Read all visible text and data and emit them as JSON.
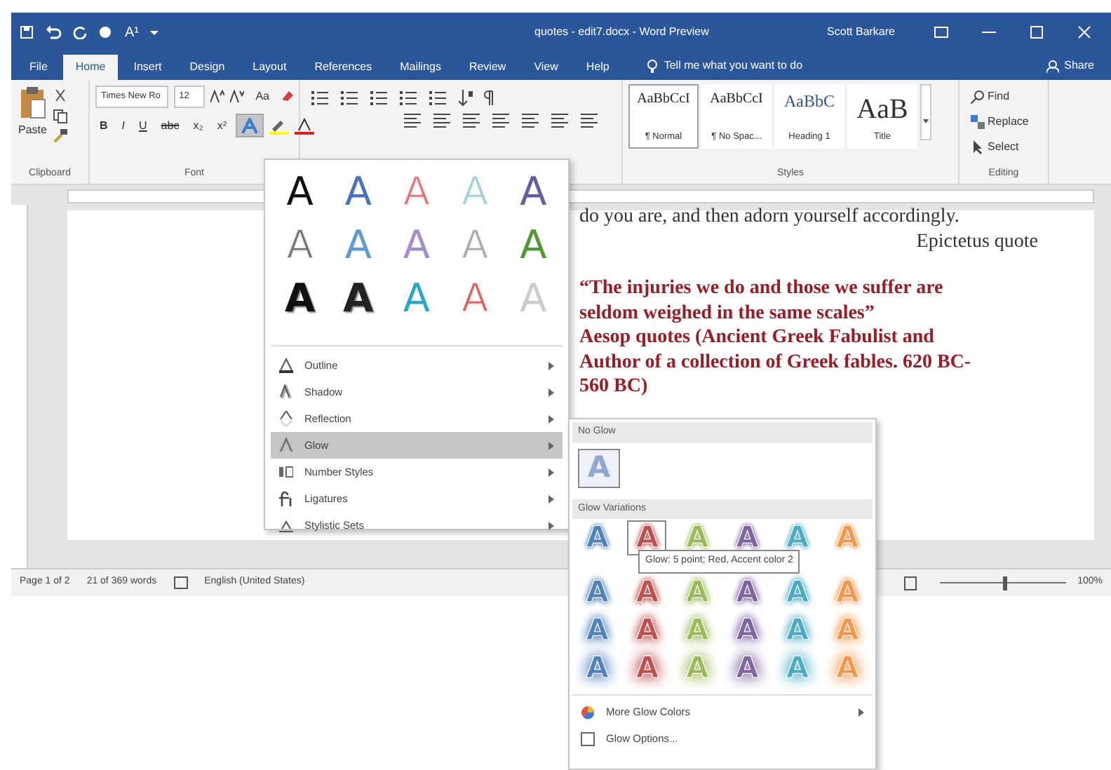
{
  "window": {
    "title": "quotes - edit7.docx - Word Preview",
    "user": "Scott Barkare",
    "qat_label": "A¹"
  },
  "tabs": [
    {
      "label": "File",
      "selected": false
    },
    {
      "label": "Home",
      "selected": true
    },
    {
      "label": "Insert",
      "selected": false
    },
    {
      "label": "Design",
      "selected": false
    },
    {
      "label": "Layout",
      "selected": false
    },
    {
      "label": "References",
      "selected": false
    },
    {
      "label": "Mailings",
      "selected": false
    },
    {
      "label": "Review",
      "selected": false
    },
    {
      "label": "View",
      "selected": false
    },
    {
      "label": "Help",
      "selected": false
    }
  ],
  "tell_me": "Tell me what you want to do",
  "share": "Share",
  "ribbon": {
    "clipboard": {
      "paste": "Paste",
      "label": "Clipboard"
    },
    "font": {
      "name": "Times New Ro",
      "size": "12",
      "case_button": "Aa",
      "format_buttons": [
        "B",
        "I",
        "U",
        "abc",
        "x₂",
        "x²"
      ],
      "text_effects_open": true,
      "label": "Font"
    },
    "styles": {
      "items": [
        {
          "preview": "AaBbCcI",
          "name": "¶ Normal",
          "kind": "normal",
          "selected": true
        },
        {
          "preview": "AaBbCcI",
          "name": "¶ No Spac...",
          "kind": "normal",
          "selected": false
        },
        {
          "preview": "AaBbC",
          "name": "Heading 1",
          "kind": "heading",
          "selected": false
        },
        {
          "preview": "AaB",
          "name": "Title",
          "kind": "title",
          "selected": false
        }
      ],
      "label": "Styles"
    },
    "editing": {
      "items": [
        {
          "label": "Find",
          "kind": "find"
        },
        {
          "label": "Replace",
          "kind": "replace"
        },
        {
          "label": "Select",
          "kind": "select"
        }
      ],
      "label": "Editing"
    }
  },
  "document": {
    "lines": [
      {
        "text": "do you are, and then adorn yourself accordingly.",
        "kind": "plain"
      },
      {
        "text": "Epictetus quote",
        "kind": "right"
      },
      {
        "text": "“The injuries we do and those we suffer are",
        "kind": "quote"
      },
      {
        "text": "seldom weighed in the same scales”",
        "kind": "quote"
      },
      {
        "text": "Aesop quotes (Ancient Greek Fabulist and",
        "kind": "quote"
      },
      {
        "text": "Author of a collection of Greek fables. 620 BC-",
        "kind": "quote"
      },
      {
        "text": "560 BC)",
        "kind": "quote"
      }
    ]
  },
  "status_bar": {
    "page": "Page 1 of 2",
    "words": "21 of 369 words",
    "language": "English (United States)",
    "zoom": "100%",
    "level": 0.5
  },
  "text_effects_menu": {
    "gallery": [
      [
        {
          "letter": "A",
          "color": "#111111",
          "kind": "solid"
        },
        {
          "letter": "A",
          "color": "#4472c4",
          "kind": "solid"
        },
        {
          "letter": "A",
          "color": "#e07878",
          "kind": "outline"
        },
        {
          "letter": "A",
          "color": "#9fd0da",
          "kind": "outline"
        },
        {
          "letter": "A",
          "color": "#6a5aa0",
          "kind": "solid"
        }
      ],
      [
        {
          "letter": "A",
          "color": "#777777",
          "kind": "outline"
        },
        {
          "letter": "A",
          "color": "#5b9bd5",
          "kind": "solid"
        },
        {
          "letter": "A",
          "color": "#a48fcc",
          "kind": "solid"
        },
        {
          "letter": "A",
          "color": "#aaaaaa",
          "kind": "outline"
        },
        {
          "letter": "A",
          "color": "#4e9a2e",
          "kind": "solid"
        }
      ],
      [
        {
          "letter": "A",
          "color": "#111111",
          "kind": "bold"
        },
        {
          "letter": "A",
          "color": "#222222",
          "kind": "bold"
        },
        {
          "letter": "A",
          "color": "#2aa6c6",
          "kind": "solid"
        },
        {
          "letter": "A",
          "color": "#e06060",
          "kind": "outline"
        },
        {
          "letter": "A",
          "color": "#cccccc",
          "kind": "solid"
        }
      ]
    ],
    "items": [
      {
        "label": "Outline",
        "kind": "outline",
        "selected": false
      },
      {
        "label": "Shadow",
        "kind": "shadow",
        "selected": false
      },
      {
        "label": "Reflection",
        "kind": "reflection",
        "selected": false
      },
      {
        "label": "Glow",
        "kind": "glow",
        "selected": true
      },
      {
        "label": "Number Styles",
        "kind": "number",
        "selected": false
      },
      {
        "label": "Ligatures",
        "kind": "ligature",
        "selected": false
      },
      {
        "label": "Stylistic Sets",
        "kind": "stylistic",
        "selected": false
      }
    ]
  },
  "glow_menu": {
    "no_glow_header": "No Glow",
    "no_glow_letter": "A",
    "variations_header": "Glow Variations",
    "rows": [
      {
        "kind": "small",
        "items": [
          {
            "letter": "A",
            "color": "#4f81bd",
            "hovered": false
          },
          {
            "letter": "A",
            "color": "#c0504d",
            "hovered": true
          },
          {
            "letter": "A",
            "color": "#9bbb59",
            "hovered": false
          },
          {
            "letter": "A",
            "color": "#8064a2",
            "hovered": false
          },
          {
            "letter": "A",
            "color": "#4bacc6",
            "hovered": false
          },
          {
            "letter": "A",
            "color": "#f79646",
            "hovered": false
          }
        ]
      },
      {
        "kind": "medium",
        "items": [
          {
            "letter": "A",
            "color": "#4f81bd",
            "hovered": false
          },
          {
            "letter": "A",
            "color": "#c0504d",
            "hovered": false
          },
          {
            "letter": "A",
            "color": "#9bbb59",
            "hovered": false
          },
          {
            "letter": "A",
            "color": "#8064a2",
            "hovered": false
          },
          {
            "letter": "A",
            "color": "#4bacc6",
            "hovered": false
          },
          {
            "letter": "A",
            "color": "#f79646",
            "hovered": false
          }
        ]
      },
      {
        "kind": "large",
        "items": [
          {
            "letter": "A",
            "color": "#4f81bd",
            "hovered": false
          },
          {
            "letter": "A",
            "color": "#c0504d",
            "hovered": false
          },
          {
            "letter": "A",
            "color": "#9bbb59",
            "hovered": false
          },
          {
            "letter": "A",
            "color": "#8064a2",
            "hovered": false
          },
          {
            "letter": "A",
            "color": "#4bacc6",
            "hovered": false
          },
          {
            "letter": "A",
            "color": "#f79646",
            "hovered": false
          }
        ]
      },
      {
        "kind": "xlarge",
        "items": [
          {
            "letter": "A",
            "color": "#4f81bd",
            "hovered": false
          },
          {
            "letter": "A",
            "color": "#c0504d",
            "hovered": false
          },
          {
            "letter": "A",
            "color": "#9bbb59",
            "hovered": false
          },
          {
            "letter": "A",
            "color": "#8064a2",
            "hovered": false
          },
          {
            "letter": "A",
            "color": "#4bacc6",
            "hovered": false
          },
          {
            "letter": "A",
            "color": "#f79646",
            "hovered": false
          }
        ]
      }
    ],
    "more_colors": "More Glow Colors",
    "options": "Glow Options...",
    "tooltip": "Glow: 5 point; Red, Accent color 2"
  }
}
